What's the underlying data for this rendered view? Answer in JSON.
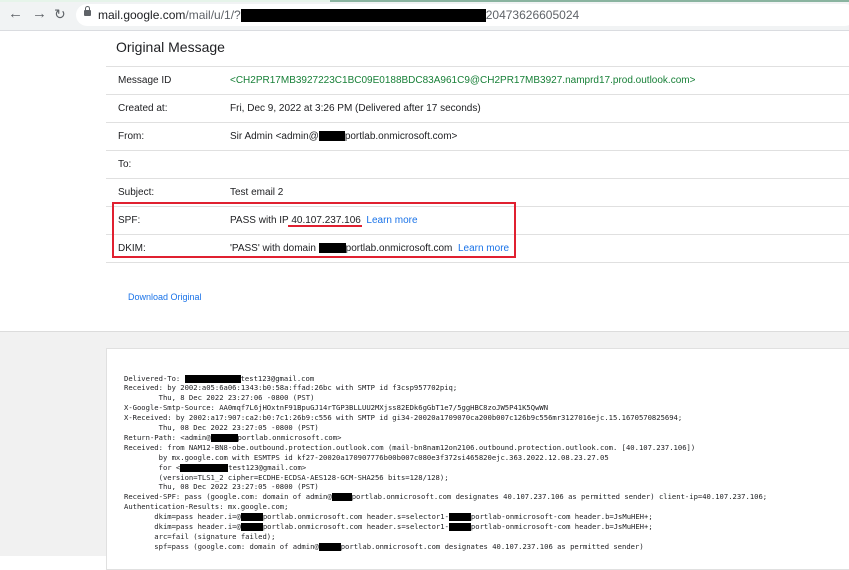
{
  "browser": {
    "back_icon": "arrow-left-icon",
    "forward_icon": "arrow-right-icon",
    "reload_icon": "reload-icon",
    "url_host": "mail.google.com",
    "url_path": "/mail/u/1/?",
    "url_tail": "20473626605024"
  },
  "page": {
    "title": "Original Message",
    "download_label": "Download Original"
  },
  "headers": {
    "message_id": {
      "label": "Message ID",
      "value": "<CH2PR17MB3927223C1BC09E0188BDC83A961C9@CH2PR17MB3927.namprd17.prod.outlook.com>"
    },
    "created_at": {
      "label": "Created at:",
      "value": "Fri, Dec 9, 2022 at 3:26 PM (Delivered after 17 seconds)"
    },
    "from": {
      "label": "From:",
      "value_prefix": "Sir Admin <admin@",
      "value_suffix": "portlab.onmicrosoft.com>"
    },
    "to": {
      "label": "To:",
      "value": ""
    },
    "subject": {
      "label": "Subject:",
      "value": "Test email 2"
    },
    "spf": {
      "label": "SPF:",
      "value_prefix": "PASS with IP ",
      "ip": "40.107.237.106",
      "learn_more": "Learn more"
    },
    "dkim": {
      "label": "DKIM:",
      "value_prefix": "'PASS' with domain ",
      "value_suffix": "portlab.onmicrosoft.com",
      "learn_more": "Learn more"
    }
  },
  "raw": {
    "l1a": "Delivered-To: ",
    "l1b": "test123@gmail.com",
    "l2": "Received: by 2002:a05:6a06:1343:b0:58a:ffad:26bc with SMTP id f3csp957702piq;",
    "l3": "        Thu, 8 Dec 2022 23:27:06 -0800 (PST)",
    "l4": "X-Google-Smtp-Source: AA0mqf7L6jHOxtnF91BpuGJ14rTGP3BLLUU2MXjss82EDk6gGbT1e7/5ggHBC8zoJW5P41K5QwWN",
    "l5": "X-Received: by 2002:a17:907:ca2:b0:7c1:26b9:c556 with SMTP id gi34-20020a1709070ca200b007c126b9c556mr3127016ejc.15.1670570825694;",
    "l6": "        Thu, 08 Dec 2022 23:27:05 -0800 (PST)",
    "l7a": "Return-Path: <admin@",
    "l7b": "portlab.onmicrosoft.com>",
    "l8": "Received: from NAM12-BN8-obe.outbound.protection.outlook.com (mail-bn8nam12on2106.outbound.protection.outlook.com. [40.107.237.106])",
    "l9": "        by mx.google.com with ESMTPS id kf27-20020a170907776b00b007c080e3f372si465820ejc.363.2022.12.08.23.27.05",
    "l10a": "        for <",
    "l10b": "test123@gmail.com>",
    "l11": "        (version=TLS1_2 cipher=ECDHE-ECDSA-AES128-GCM-SHA256 bits=128/128);",
    "l12": "        Thu, 08 Dec 2022 23:27:05 -0800 (PST)",
    "l13a": "Received-SPF: pass (google.com: domain of admin@",
    "l13b": "portlab.onmicrosoft.com designates 40.107.237.106 as permitted sender) client-ip=40.107.237.106;",
    "l14": "Authentication-Results: mx.google.com;",
    "l15a": "       dkim=pass header.i=@",
    "l15b": "portlab.onmicrosoft.com header.s=selector1-",
    "l15c": "portlab-onmicrosoft-com header.b=JsMuHEH+;",
    "l16a": "       dkim=pass header.i=@",
    "l16b": "portlab.onmicrosoft.com header.s=selector1-",
    "l16c": "portlab-onmicrosoft-com header.b=JsMuHEH+;",
    "l17": "       arc=fail (signature failed);",
    "l18a": "       spf=pass (google.com: domain of admin@",
    "l18b": "portlab.onmicrosoft.com designates 40.107.237.106 as permitted sender)"
  }
}
